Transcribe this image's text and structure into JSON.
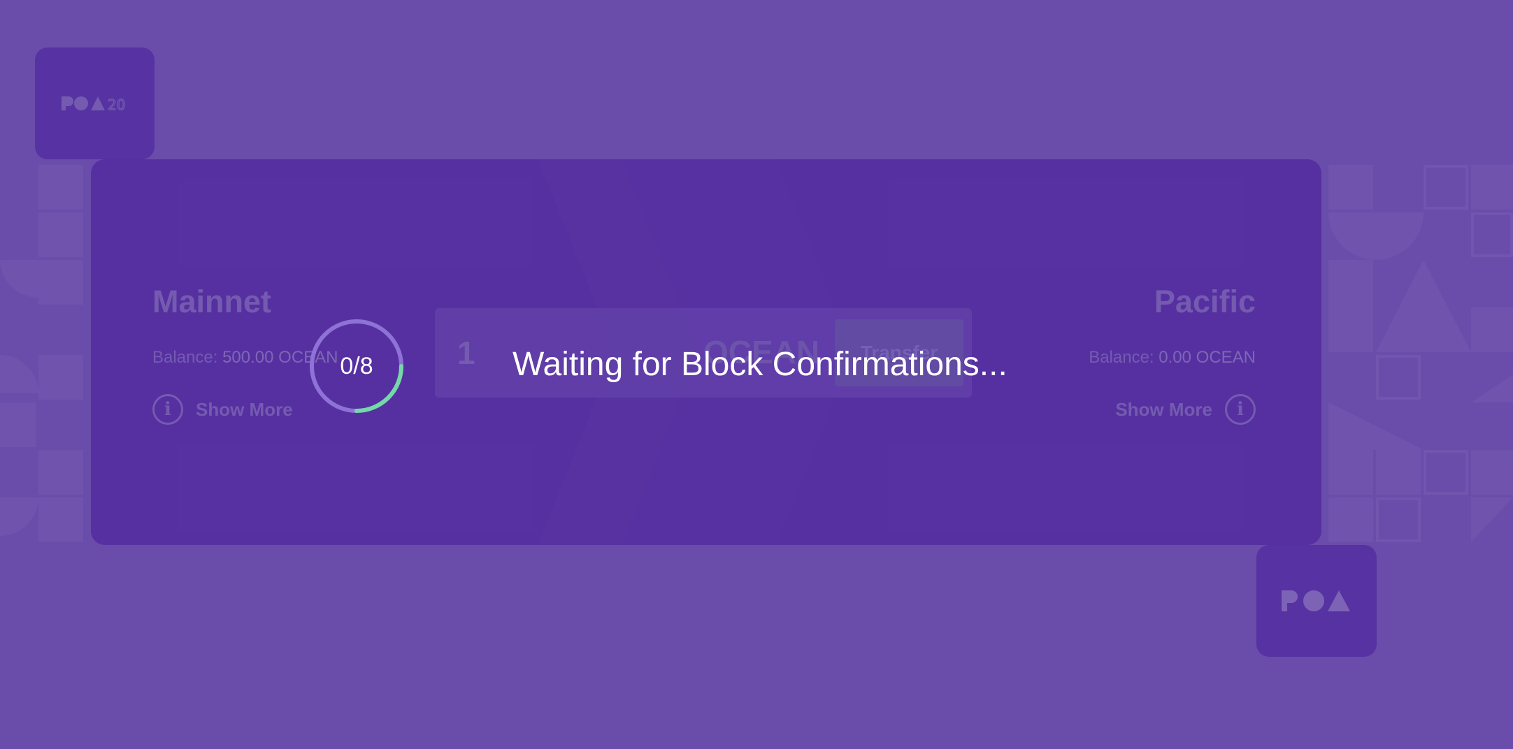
{
  "brand": {
    "top_logo": "POA20",
    "bottom_logo": "POA"
  },
  "bridge": {
    "home": {
      "network": "Mainnet",
      "balance_label": "Balance:",
      "balance_value": "500.00 OCEAN",
      "show_more": "Show More"
    },
    "foreign": {
      "network": "Pacific",
      "balance_label": "Balance:",
      "balance_value": "0.00 OCEAN",
      "show_more": "Show More"
    },
    "form": {
      "amount": "1",
      "token": "OCEAN",
      "transfer_label": "Transfer"
    }
  },
  "overlay": {
    "confirmations_text": "0/8",
    "confirmations_done": 0,
    "confirmations_total": 8,
    "message": "Waiting for Block Confirmations..."
  },
  "colors": {
    "background": "#8a6fcf",
    "card": "#6a42c0",
    "accent_progress": "#74d9a8"
  }
}
